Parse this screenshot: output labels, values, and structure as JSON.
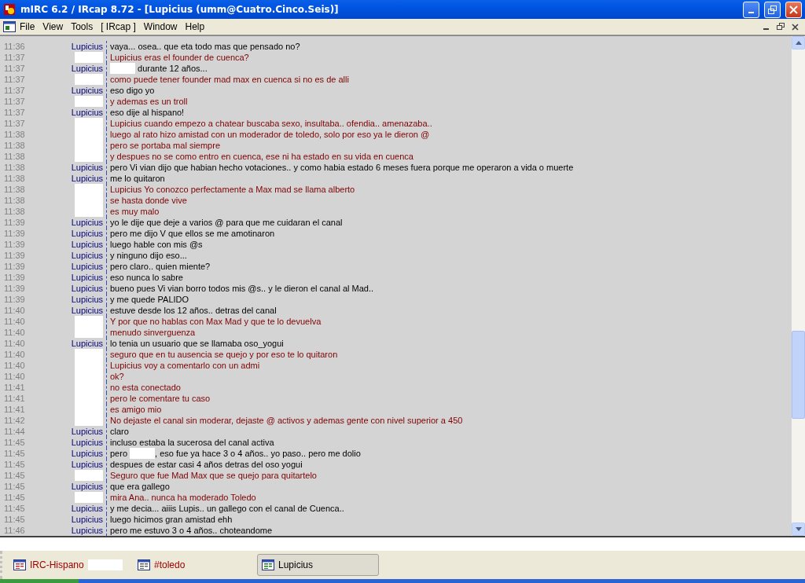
{
  "window": {
    "title": "mIRC 6.2 / IRcap 8.72 - [Lupicius (umm@Cuatro.Cinco.Seis)]"
  },
  "menu": [
    "File",
    "View",
    "Tools",
    "[ IRcap ]",
    "Window",
    "Help"
  ],
  "messages": [
    {
      "time": "11:36",
      "kind": "self",
      "nick": "Lupicius",
      "text": "vaya... osea.. que eta todo mas que pensado no?"
    },
    {
      "time": "11:37",
      "kind": "other",
      "text": "Lupicius eras el founder de cuenca?"
    },
    {
      "time": "11:37",
      "kind": "self",
      "nick": "Lupicius",
      "parts": [
        {
          "kind": "redacted"
        },
        {
          "kind": "text",
          "text": " durante 12 años..."
        }
      ]
    },
    {
      "time": "11:37",
      "kind": "other",
      "text": "como puede tener founder mad max en cuenca si no es de alli"
    },
    {
      "time": "11:37",
      "kind": "self",
      "nick": "Lupicius",
      "text": "eso digo yo"
    },
    {
      "time": "11:37",
      "kind": "other",
      "text": "y ademas es un troll"
    },
    {
      "time": "11:37",
      "kind": "self",
      "nick": "Lupicius",
      "text": "eso dije al hispano!"
    },
    {
      "time": "11:37",
      "kind": "other",
      "text": "Lupicius cuando empezo a chatear buscaba sexo, insultaba.. ofendia.. amenazaba.."
    },
    {
      "time": "11:38",
      "kind": "other",
      "text": "luego al rato hizo amistad con un moderador de toledo, solo por eso ya le dieron @"
    },
    {
      "time": "11:38",
      "kind": "other",
      "text": "pero se portaba mal siempre"
    },
    {
      "time": "11:38",
      "kind": "other",
      "text": "y despues no se como entro en cuenca, ese ni ha estado en su vida en cuenca"
    },
    {
      "time": "11:38",
      "kind": "self",
      "nick": "Lupicius",
      "text": "pero Vi vian dijo que habian hecho votaciones.. y como habia estado 6 meses fuera porque me operaron a vida o muerte"
    },
    {
      "time": "11:38",
      "kind": "self",
      "nick": "Lupicius",
      "text": "me lo quitaron"
    },
    {
      "time": "11:38",
      "kind": "other",
      "text": "Lupicius Yo conozco perfectamente a Max mad se llama alberto"
    },
    {
      "time": "11:38",
      "kind": "other",
      "text": "se hasta donde vive"
    },
    {
      "time": "11:38",
      "kind": "other",
      "text": "es muy malo"
    },
    {
      "time": "11:39",
      "kind": "self",
      "nick": "Lupicius",
      "text": "yo le dije que deje a varios @ para que me cuidaran el canal"
    },
    {
      "time": "11:39",
      "kind": "self",
      "nick": "Lupicius",
      "text": "pero me dijo V que ellos se me amotinaron"
    },
    {
      "time": "11:39",
      "kind": "self",
      "nick": "Lupicius",
      "text": "luego hable con mis @s"
    },
    {
      "time": "11:39",
      "kind": "self",
      "nick": "Lupicius",
      "text": "y ninguno dijo eso..."
    },
    {
      "time": "11:39",
      "kind": "self",
      "nick": "Lupicius",
      "text": "pero claro.. quien miente?"
    },
    {
      "time": "11:39",
      "kind": "self",
      "nick": "Lupicius",
      "text": "eso nunca lo sabre"
    },
    {
      "time": "11:39",
      "kind": "self",
      "nick": "Lupicius",
      "text": "bueno pues Vi vian borro todos mis @s.. y le dieron el canal al Mad.."
    },
    {
      "time": "11:39",
      "kind": "self",
      "nick": "Lupicius",
      "text": "y me quede PALIDO"
    },
    {
      "time": "11:40",
      "kind": "self",
      "nick": "Lupicius",
      "text": "estuve desde los 12 años.. detras del canal"
    },
    {
      "time": "11:40",
      "kind": "other",
      "text": "Y por que no hablas con Max Mad y que te lo devuelva"
    },
    {
      "time": "11:40",
      "kind": "other",
      "text": "menudo sinverguenza"
    },
    {
      "time": "11:40",
      "kind": "self",
      "nick": "Lupicius",
      "text": "lo tenia un usuario que se llamaba oso_yogui"
    },
    {
      "time": "11:40",
      "kind": "other",
      "text": "seguro que en tu ausencia se quejo y por eso te lo quitaron"
    },
    {
      "time": "11:40",
      "kind": "other",
      "text": "Lupicius voy a comentarlo con un admi"
    },
    {
      "time": "11:40",
      "kind": "other",
      "text": "ok?"
    },
    {
      "time": "11:41",
      "kind": "other",
      "text": "no esta conectado"
    },
    {
      "time": "11:41",
      "kind": "other",
      "text": "pero le comentare tu caso"
    },
    {
      "time": "11:41",
      "kind": "other",
      "text": "es amigo mio"
    },
    {
      "time": "11:42",
      "kind": "other",
      "text": "No dejaste el canal sin moderar, dejaste @ activos y ademas gente con nivel superior a 450"
    },
    {
      "time": "11:44",
      "kind": "self",
      "nick": "Lupicius",
      "text": "claro"
    },
    {
      "time": "11:45",
      "kind": "self",
      "nick": "Lupicius",
      "text": "incluso estaba la sucerosa del canal activa"
    },
    {
      "time": "11:45",
      "kind": "self",
      "nick": "Lupicius",
      "parts": [
        {
          "kind": "text",
          "text": "pero "
        },
        {
          "kind": "redacted"
        },
        {
          "kind": "text",
          "text": ", eso fue ya hace 3 o 4 años.. yo paso.. pero me dolio"
        }
      ]
    },
    {
      "time": "11:45",
      "kind": "self",
      "nick": "Lupicius",
      "text": "despues de estar casi 4 años detras del oso yogui"
    },
    {
      "time": "11:45",
      "kind": "other",
      "text": "Seguro que fue Mad Max que se quejo para quitartelo"
    },
    {
      "time": "11:45",
      "kind": "self",
      "nick": "Lupicius",
      "text": "que era gallego"
    },
    {
      "time": "11:45",
      "kind": "other",
      "text": "mira Ana.. nunca ha moderado Toledo"
    },
    {
      "time": "11:45",
      "kind": "self",
      "nick": "Lupicius",
      "text": "y me decia... aiiis Lupis.. un gallego con el canal de Cuenca.."
    },
    {
      "time": "11:45",
      "kind": "self",
      "nick": "Lupicius",
      "text": "luego hicimos gran amistad ehh"
    },
    {
      "time": "11:46",
      "kind": "self",
      "nick": "Lupicius",
      "text": "pero me estuvo 3 o 4 años.. choteandome"
    }
  ],
  "switchbar": [
    {
      "kind": "status",
      "label": "IRC-Hispano",
      "redacted": true,
      "activity": true,
      "selected": false
    },
    {
      "kind": "channel",
      "label": "#toledo",
      "redacted": false,
      "activity": true,
      "selected": false
    },
    {
      "kind": "query",
      "label": "Lupicius",
      "redacted": false,
      "activity": false,
      "selected": true
    }
  ]
}
